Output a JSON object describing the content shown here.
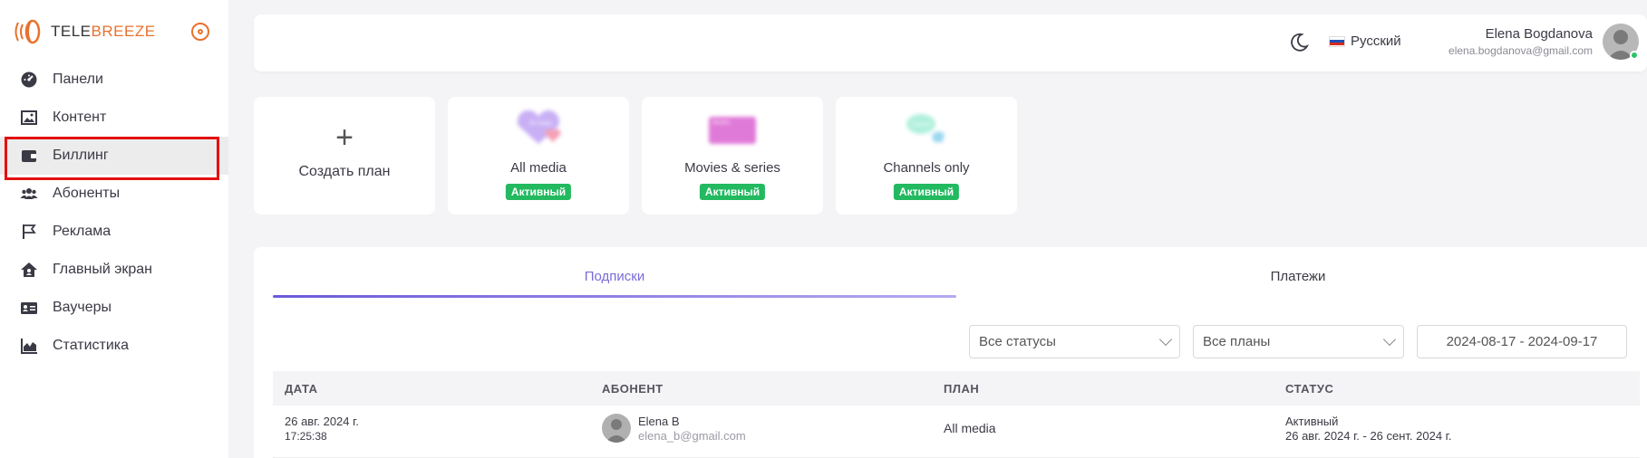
{
  "brand": {
    "name_part1": "TELE",
    "name_part2": "BREEZE",
    "accent_color": "#e8712c"
  },
  "sidebar": {
    "items": [
      {
        "label": "Панели",
        "icon": "dashboard-icon"
      },
      {
        "label": "Контент",
        "icon": "image-icon"
      },
      {
        "label": "Биллинг",
        "icon": "wallet-icon",
        "active": true
      },
      {
        "label": "Абоненты",
        "icon": "users-icon"
      },
      {
        "label": "Реклама",
        "icon": "flag-icon"
      },
      {
        "label": "Главный экран",
        "icon": "home-icon"
      },
      {
        "label": "Ваучеры",
        "icon": "id-card-icon"
      },
      {
        "label": "Статистика",
        "icon": "chart-icon"
      }
    ]
  },
  "header": {
    "language": "Русский",
    "user_name": "Elena Bogdanova",
    "user_email": "elena.bogdanova@gmail.com"
  },
  "plans": {
    "create_label": "Создать план",
    "items": [
      {
        "name": "All media",
        "status": "Активный",
        "thumb_text": "All media"
      },
      {
        "name": "Movies & series",
        "status": "Активный",
        "thumb_text": "Movies"
      },
      {
        "name": "Channels only",
        "status": "Активный",
        "thumb_text": "Channels"
      }
    ]
  },
  "tabs": {
    "subscriptions": "Подписки",
    "payments": "Платежи"
  },
  "filters": {
    "status": "Все статусы",
    "plan": "Все планы",
    "date_range": "2024-08-17 - 2024-09-17"
  },
  "table": {
    "headers": [
      "ДАТА",
      "АБОНЕНТ",
      "ПЛАН",
      "СТАТУС"
    ],
    "rows": [
      {
        "date": "26 авг. 2024 г.",
        "time": "17:25:38",
        "subscriber_name": "Elena B",
        "subscriber_email": "elena_b@gmail.com",
        "plan": "All media",
        "status": "Активный",
        "period": "26 авг. 2024 г. - 26 сент. 2024 г."
      }
    ]
  }
}
